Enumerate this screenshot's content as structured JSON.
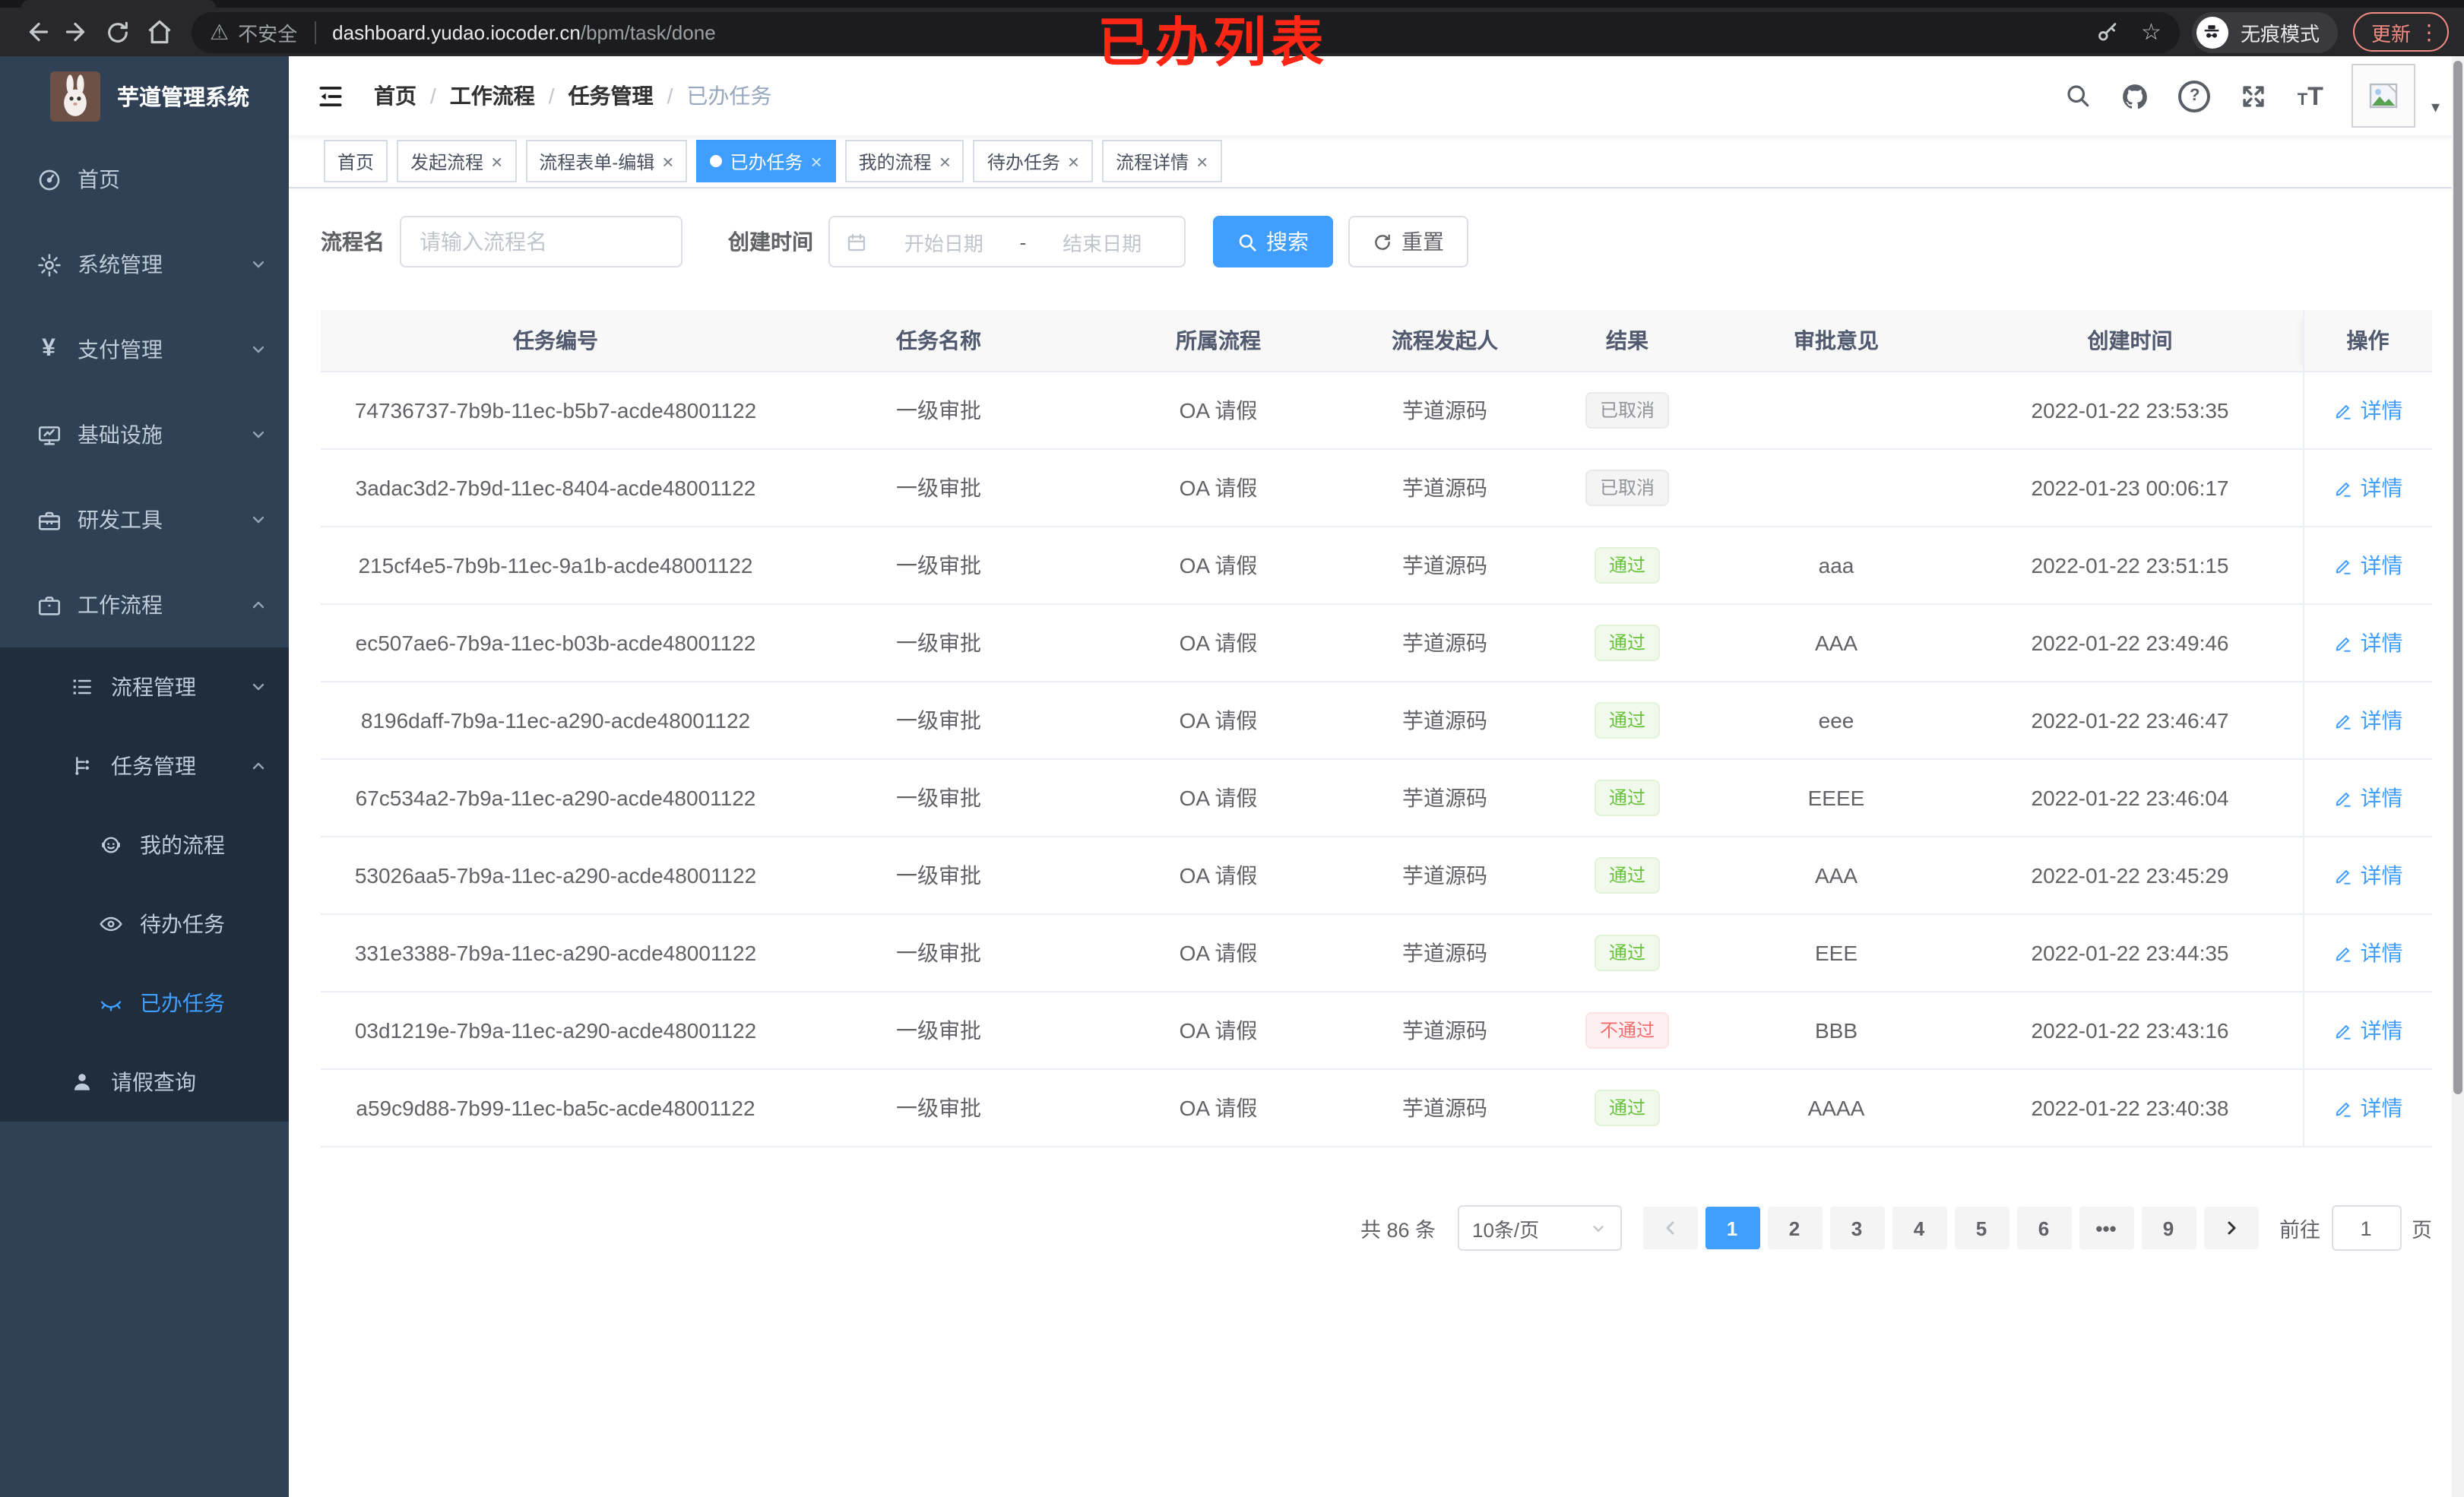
{
  "colors": {
    "primary": "#409eff",
    "success": "#67c23a",
    "danger": "#f56c6c",
    "info": "#909399",
    "sidebar_bg": "#304156",
    "submenu_bg": "#1f2d3d",
    "annotation_red": "#ff2616"
  },
  "browser": {
    "security": "不安全",
    "url_host": "dashboard.yudao.iocoder.cn",
    "url_path": "/bpm/task/done",
    "incognito": "无痕模式",
    "update": "更新",
    "annotation": "已办列表"
  },
  "sidebar": {
    "title": "芋道管理系统",
    "items": [
      "首页",
      "系统管理",
      "支付管理",
      "基础设施",
      "研发工具",
      "工作流程",
      "流程管理",
      "任务管理",
      "我的流程",
      "待办任务",
      "已办任务",
      "请假查询"
    ]
  },
  "navbar": {
    "breadcrumb": [
      "首页",
      "工作流程",
      "任务管理",
      "已办任务"
    ]
  },
  "tabs": [
    "首页",
    "发起流程",
    "流程表单-编辑",
    "已办任务",
    "我的流程",
    "待办任务",
    "流程详情"
  ],
  "filters": {
    "name_label": "流程名",
    "name_placeholder": "请输入流程名",
    "time_label": "创建时间",
    "start_placeholder": "开始日期",
    "range_separator": "-",
    "end_placeholder": "结束日期",
    "search_label": "搜索",
    "reset_label": "重置"
  },
  "table": {
    "columns": [
      "任务编号",
      "任务名称",
      "所属流程",
      "流程发起人",
      "结果",
      "审批意见",
      "创建时间",
      "操作"
    ],
    "action_label": "详情",
    "rows": [
      {
        "id": "74736737-7b9b-11ec-b5b7-acde48001122",
        "name": "一级审批",
        "process": "OA 请假",
        "starter": "芋道源码",
        "result": "已取消",
        "comment": "",
        "created": "2022-01-22 23:53:35"
      },
      {
        "id": "3adac3d2-7b9d-11ec-8404-acde48001122",
        "name": "一级审批",
        "process": "OA 请假",
        "starter": "芋道源码",
        "result": "已取消",
        "comment": "",
        "created": "2022-01-23 00:06:17"
      },
      {
        "id": "215cf4e5-7b9b-11ec-9a1b-acde48001122",
        "name": "一级审批",
        "process": "OA 请假",
        "starter": "芋道源码",
        "result": "通过",
        "comment": "aaa",
        "created": "2022-01-22 23:51:15"
      },
      {
        "id": "ec507ae6-7b9a-11ec-b03b-acde48001122",
        "name": "一级审批",
        "process": "OA 请假",
        "starter": "芋道源码",
        "result": "通过",
        "comment": "AAA",
        "created": "2022-01-22 23:49:46"
      },
      {
        "id": "8196daff-7b9a-11ec-a290-acde48001122",
        "name": "一级审批",
        "process": "OA 请假",
        "starter": "芋道源码",
        "result": "通过",
        "comment": "eee",
        "created": "2022-01-22 23:46:47"
      },
      {
        "id": "67c534a2-7b9a-11ec-a290-acde48001122",
        "name": "一级审批",
        "process": "OA 请假",
        "starter": "芋道源码",
        "result": "通过",
        "comment": "EEEE",
        "created": "2022-01-22 23:46:04"
      },
      {
        "id": "53026aa5-7b9a-11ec-a290-acde48001122",
        "name": "一级审批",
        "process": "OA 请假",
        "starter": "芋道源码",
        "result": "通过",
        "comment": "AAA",
        "created": "2022-01-22 23:45:29"
      },
      {
        "id": "331e3388-7b9a-11ec-a290-acde48001122",
        "name": "一级审批",
        "process": "OA 请假",
        "starter": "芋道源码",
        "result": "通过",
        "comment": "EEE",
        "created": "2022-01-22 23:44:35"
      },
      {
        "id": "03d1219e-7b9a-11ec-a290-acde48001122",
        "name": "一级审批",
        "process": "OA 请假",
        "starter": "芋道源码",
        "result": "不通过",
        "comment": "BBB",
        "created": "2022-01-22 23:43:16"
      },
      {
        "id": "a59c9d88-7b99-11ec-ba5c-acde48001122",
        "name": "一级审批",
        "process": "OA 请假",
        "starter": "芋道源码",
        "result": "通过",
        "comment": "AAAA",
        "created": "2022-01-22 23:40:38"
      }
    ]
  },
  "pagination": {
    "total": "共 86 条",
    "page_size": "10条/页",
    "pages": [
      "1",
      "2",
      "3",
      "4",
      "5",
      "6",
      "•••",
      "9"
    ],
    "goto_label": "前往",
    "goto_value": "1",
    "page_unit": "页"
  }
}
